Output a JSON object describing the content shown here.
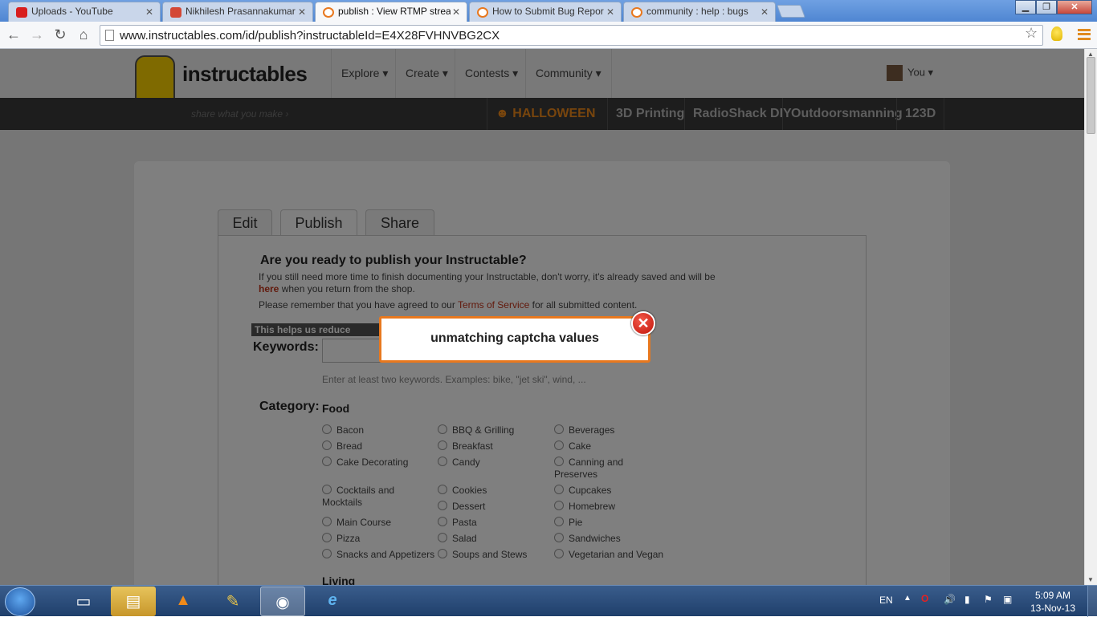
{
  "browser": {
    "tabs": [
      {
        "label": "Uploads - YouTube",
        "icon": "youtube-icon",
        "color": "#d81e1e"
      },
      {
        "label": "Nikhilesh Prasannakumar",
        "icon": "google-plus-icon",
        "color": "#d34836"
      },
      {
        "label": "publish : View RTMP strea",
        "icon": "instructables-icon",
        "color": "#e8781e"
      },
      {
        "label": "How to Submit Bug Repor",
        "icon": "instructables-icon",
        "color": "#e8781e"
      },
      {
        "label": "community : help : bugs",
        "icon": "instructables-icon",
        "color": "#e8781e"
      }
    ],
    "url": "www.instructables.com/id/publish?instructableId=E4X28FVHNVBG2CX"
  },
  "site": {
    "logo_text": "instructables",
    "tagline": "share what you make",
    "nav": [
      "Explore",
      "Create",
      "Contests",
      "Community"
    ],
    "user": "You",
    "channels": [
      "HALLOWEEN",
      "3D Printing",
      "RadioShack DIY",
      "Outdoorsmanning",
      "123D"
    ]
  },
  "publish": {
    "tabs": [
      "Edit",
      "Publish",
      "Share"
    ],
    "question": "Are you ready to publish your Instructable?",
    "info_line1": "If you still need more time to finish documenting your Instructable, don't worry, it's already saved and will be",
    "info_here": "here",
    "info_line2": " when you return from the shop.",
    "remember_pre": "Please remember that you have agreed to our ",
    "remember_link": "Terms of Service",
    "remember_post": " for all submitted content.",
    "spam_note": "This helps us reduce spam",
    "keywords_label": "Keywords:",
    "keywords_help": "Enter at least two keywords. Examples: bike, \"jet ski\", wind, ...",
    "category_label": "Category:",
    "food_heading": "Food",
    "food_categories": [
      "Bacon",
      "BBQ & Grilling",
      "Beverages",
      "Bread",
      "Breakfast",
      "Cake",
      "Cake Decorating",
      "Candy",
      "Canning and Preserves",
      "Cocktails and Mocktails",
      "Cookies",
      "Cupcakes",
      "Dessert",
      "Homebrew",
      "Main Course",
      "Pasta",
      "Pie",
      "Pizza",
      "Salad",
      "Sandwiches",
      "Snacks and Appetizers",
      "Soups and Stews",
      "Vegetarian and Vegan"
    ],
    "living_heading": "Living"
  },
  "modal": {
    "message": "unmatching captcha values"
  },
  "taskbar": {
    "language": "EN",
    "time": "5:09 AM",
    "date": "13-Nov-13"
  }
}
